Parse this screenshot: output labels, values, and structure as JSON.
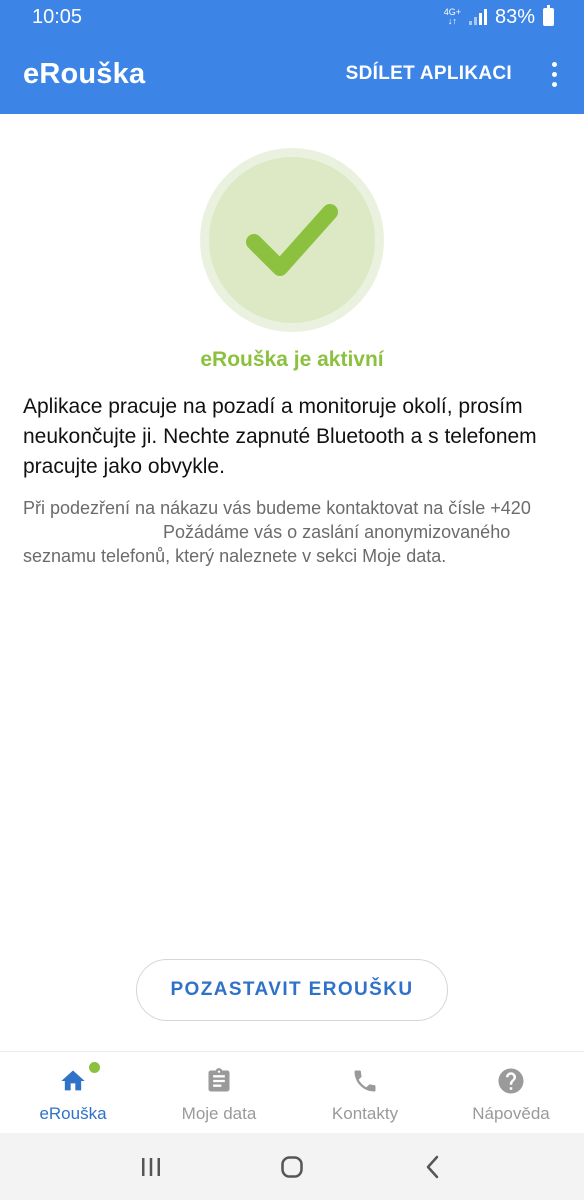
{
  "status_bar": {
    "time": "10:05",
    "network_top": "4G+",
    "network_bottom": "↓↑",
    "battery": "83%"
  },
  "app_bar": {
    "title": "eRouška",
    "share_label": "SDÍLET APLIKACI",
    "menu_icon": "more-vert-icon"
  },
  "status": {
    "icon": "check-icon",
    "title": "eRouška je aktivní",
    "main_text": "Aplikace pracuje na pozadí a monitoruje okolí, prosím neukončujte ji. Nechte zapnuté Bluetooth a s telefonem pracujte jako obvykle.",
    "sub_text_1": "Při podezření na nákazu vás budeme kontaktovat na čísle +420",
    "sub_text_2": "Požádáme vás o zaslání anonymizovaného seznamu telefonů, který naleznete v sekci Moje data."
  },
  "pause_button": {
    "label": "POZASTAVIT EROUŠKU"
  },
  "bottom_nav": {
    "items": [
      {
        "label": "eRouška",
        "icon": "home-icon",
        "active": true
      },
      {
        "label": "Moje data",
        "icon": "clipboard-icon",
        "active": false
      },
      {
        "label": "Kontakty",
        "icon": "phone-icon",
        "active": false
      },
      {
        "label": "Nápověda",
        "icon": "help-icon",
        "active": false
      }
    ]
  },
  "colors": {
    "primary": "#3c85e6",
    "accent_green": "#8bc13e",
    "link_blue": "#2f72c7"
  }
}
